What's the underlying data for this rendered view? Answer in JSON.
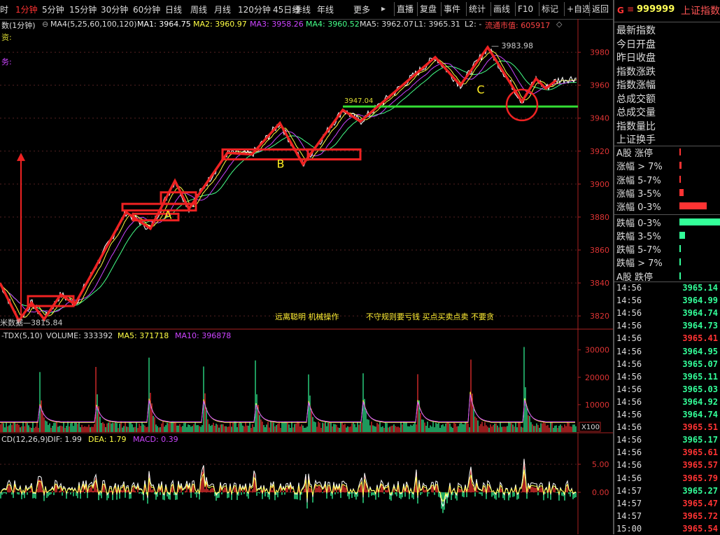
{
  "toolbar": {
    "periods": [
      {
        "label": "时",
        "active": false
      },
      {
        "label": "1分钟",
        "active": true
      },
      {
        "label": "5分钟",
        "active": false
      },
      {
        "label": "15分钟",
        "active": false
      },
      {
        "label": "30分钟",
        "active": false
      },
      {
        "label": "60分钟",
        "active": false
      },
      {
        "label": "日线",
        "active": false
      },
      {
        "label": "周线",
        "active": false
      },
      {
        "label": "月线",
        "active": false
      },
      {
        "label": "120分钟",
        "active": false
      },
      {
        "label": "45日线",
        "active": false
      },
      {
        "label": "季线",
        "active": false
      },
      {
        "label": "年线",
        "active": false
      },
      {
        "label": "更多",
        "active": false
      }
    ],
    "more_arrow": "▸",
    "buttons": [
      "直播",
      "复盘",
      "事件",
      "统计",
      "画线",
      "F10",
      "标记",
      "+自选",
      "返回"
    ]
  },
  "indicator_line": {
    "name": "数(1分钟)",
    "settings": "MA4(5,25,60,100,120)",
    "ma1": "MA1: 3964.75",
    "ma2": "MA2: 3960.97",
    "ma3": "MA3: 3958.26",
    "ma4": "MA4: 3960.52",
    "ma5": "MA5: 3962.07",
    "l1": "L1: 3965.31",
    "l2": "L2: -",
    "market_value": "流通市值: 605917",
    "left_label_1": "资:",
    "left_label_2": "务:"
  },
  "colors": {
    "up": "#ff3333",
    "down": "#33ff99",
    "price": "#ffffff",
    "ma_yellow": "#ffff44",
    "ma_purple": "#cc44ff",
    "ma_green": "#44ff88",
    "support": "#33dd33",
    "annot": "#ee2222"
  },
  "price_chart": {
    "type": "line",
    "y_ticks": [
      3980,
      3960,
      3940,
      3920,
      3900,
      3880,
      3860,
      3840,
      3820
    ],
    "ylim": [
      3812,
      3993
    ],
    "high_label": "3983.98",
    "low_label": "3815.84",
    "support_value_label": "3947.04",
    "support_level": 3947.04,
    "annotations": [
      "A",
      "B",
      "C"
    ],
    "notes": [
      "远离聪明 机械操作",
      "不守规则要亏钱 买点买卖点卖 不要贪"
    ],
    "low_prefix": "米数据—",
    "trend_path_values": [
      [
        0,
        3840
      ],
      [
        27,
        3817
      ],
      [
        45,
        3828
      ],
      [
        63,
        3818
      ],
      [
        87,
        3833
      ],
      [
        107,
        3827
      ],
      [
        180,
        3883
      ],
      [
        215,
        3873
      ],
      [
        250,
        3902
      ],
      [
        270,
        3885
      ],
      [
        325,
        3919
      ],
      [
        360,
        3918
      ],
      [
        400,
        3937
      ],
      [
        433,
        3912
      ],
      [
        490,
        3945
      ],
      [
        515,
        3938
      ],
      [
        622,
        3977
      ],
      [
        658,
        3960
      ],
      [
        697,
        3983
      ],
      [
        746,
        3950
      ],
      [
        766,
        3964
      ],
      [
        780,
        3958
      ],
      [
        795,
        3963
      ]
    ]
  },
  "volume_chart": {
    "header": "-TDX(5,10)",
    "volume": "VOLUME: 333392",
    "ma5": "MA5: 371718",
    "ma10": "MA10: 396878",
    "y_ticks": [
      30000,
      20000,
      10000
    ],
    "unit": "X100"
  },
  "macd_chart": {
    "header": "CD(12,26,9)",
    "dif": "DIF: 1.99",
    "dea": "DEA: 1.79",
    "macd": "MACD: 0.39",
    "y_ticks": [
      "5.00",
      "0.00"
    ]
  },
  "side": {
    "g": "G",
    "menu": "≡",
    "code": "999999",
    "name": "上证指数",
    "fields": [
      "最新指数",
      "今日开盘",
      "昨日收盘",
      "指数涨跌",
      "指数涨幅",
      "总成交额",
      "总成交量",
      "指数量比",
      "上证换手"
    ],
    "distribution": [
      {
        "label": "A股 涨停",
        "color": "up",
        "value": 0.02
      },
      {
        "label": "涨幅 > 7%",
        "color": "up",
        "value": 0.04
      },
      {
        "label": "涨幅 5-7%",
        "color": "up",
        "value": 0.03
      },
      {
        "label": "涨幅 3-5%",
        "color": "up",
        "value": 0.08
      },
      {
        "label": "涨幅 0-3%",
        "color": "up",
        "value": 0.55
      },
      {
        "label": "跌幅 0-3%",
        "color": "down",
        "value": 0.85
      },
      {
        "label": "跌幅 3-5%",
        "color": "down",
        "value": 0.11
      },
      {
        "label": "跌幅 5-7%",
        "color": "down",
        "value": 0.02
      },
      {
        "label": "跌幅 > 7%",
        "color": "down",
        "value": 0.02
      },
      {
        "label": "A股 跌停",
        "color": "down",
        "value": 0.02
      }
    ],
    "trades": [
      {
        "time": "14:56",
        "price": "3965.14",
        "dir": "down"
      },
      {
        "time": "14:56",
        "price": "3964.99",
        "dir": "down"
      },
      {
        "time": "14:56",
        "price": "3964.74",
        "dir": "down"
      },
      {
        "time": "14:56",
        "price": "3964.73",
        "dir": "down"
      },
      {
        "time": "14:56",
        "price": "3965.41",
        "dir": "up"
      },
      {
        "time": "14:56",
        "price": "3964.95",
        "dir": "down"
      },
      {
        "time": "14:56",
        "price": "3965.07",
        "dir": "down"
      },
      {
        "time": "14:56",
        "price": "3965.11",
        "dir": "down"
      },
      {
        "time": "14:56",
        "price": "3965.03",
        "dir": "down"
      },
      {
        "time": "14:56",
        "price": "3964.92",
        "dir": "down"
      },
      {
        "time": "14:56",
        "price": "3964.74",
        "dir": "down"
      },
      {
        "time": "14:56",
        "price": "3965.51",
        "dir": "up"
      },
      {
        "time": "14:56",
        "price": "3965.17",
        "dir": "down"
      },
      {
        "time": "14:56",
        "price": "3965.61",
        "dir": "up"
      },
      {
        "time": "14:56",
        "price": "3965.57",
        "dir": "up"
      },
      {
        "time": "14:56",
        "price": "3965.79",
        "dir": "up"
      },
      {
        "time": "14:57",
        "price": "3965.27",
        "dir": "down"
      },
      {
        "time": "14:57",
        "price": "3965.47",
        "dir": "up"
      },
      {
        "time": "14:57",
        "price": "3965.72",
        "dir": "up"
      },
      {
        "time": "15:00",
        "price": "3965.54",
        "dir": "up"
      }
    ]
  }
}
